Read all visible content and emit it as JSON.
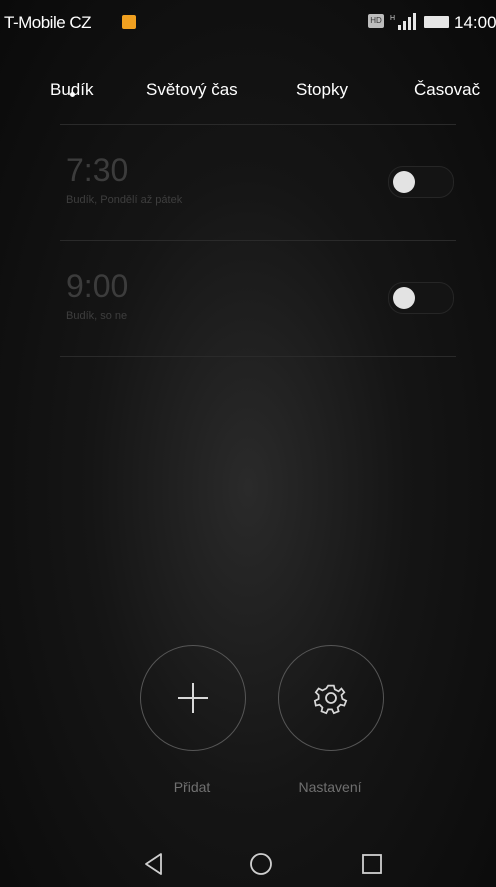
{
  "status_bar": {
    "carrier": "T-Mobile CZ",
    "time": "14:00",
    "sim_label": "HD"
  },
  "tabs": [
    {
      "label": "Budík",
      "active": true
    },
    {
      "label": "Světový čas",
      "active": false
    },
    {
      "label": "Stopky",
      "active": false
    },
    {
      "label": "Časovač",
      "active": false
    }
  ],
  "alarms": [
    {
      "time": "7:30",
      "label": "Budík, Pondělí až pátek",
      "enabled": false
    },
    {
      "time": "9:00",
      "label": "Budík, so ne",
      "enabled": false
    }
  ],
  "actions": {
    "add_label": "Přidat",
    "settings_label": "Nastavení"
  },
  "icons": {
    "add": "plus-icon",
    "settings": "gear-icon",
    "back": "back-triangle-icon",
    "home": "home-circle-icon",
    "recents": "recents-square-icon"
  }
}
